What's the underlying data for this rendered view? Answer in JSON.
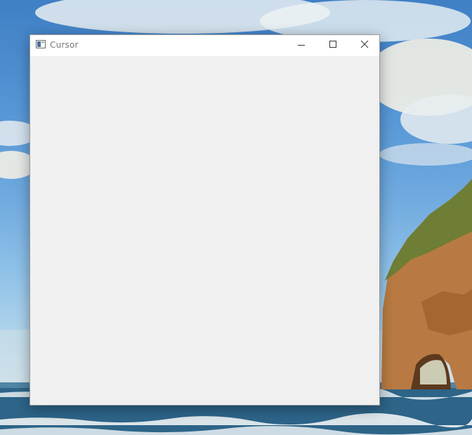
{
  "desktop": {
    "wallpaper": "sea-arch-beach",
    "colors": {
      "sky": "#5596d6",
      "cloud": "#f2f2ec",
      "rock": "#b8743a",
      "grass": "#6e7e34",
      "sea": "#2a5f86",
      "foam": "#eef3f5"
    }
  },
  "window": {
    "title": "Cursor",
    "icon": "window-app-icon",
    "controls": {
      "minimize": "minimize-icon",
      "maximize": "maximize-icon",
      "close": "close-icon"
    },
    "client_background": "#f0f0f0"
  }
}
